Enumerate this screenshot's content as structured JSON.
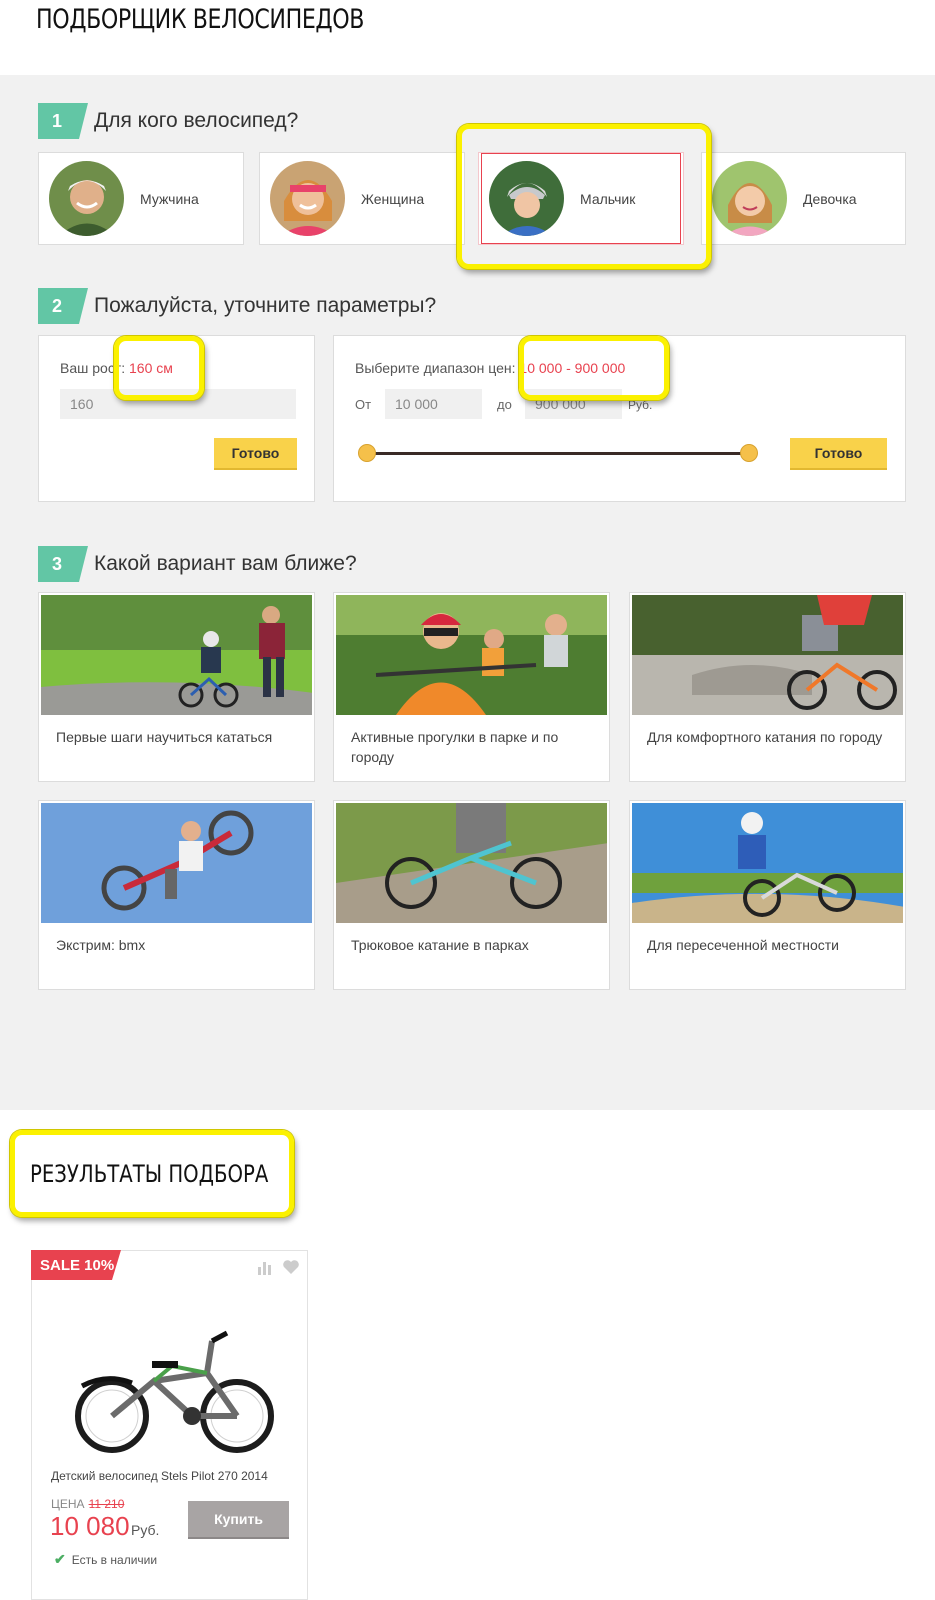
{
  "page": {
    "title": "ПОДБОРЩИК ВЕЛОСИПЕДОВ"
  },
  "step1": {
    "number": "1",
    "title": "Для кого велосипед?",
    "options": [
      {
        "label": "Мужчина",
        "icon": "man-avatar"
      },
      {
        "label": "Женщина",
        "icon": "woman-avatar"
      },
      {
        "label": "Мальчик",
        "icon": "boy-avatar",
        "selected": true
      },
      {
        "label": "Девочка",
        "icon": "girl-avatar"
      }
    ]
  },
  "step2": {
    "number": "2",
    "title": "Пожалуйста, уточните параметры?",
    "height": {
      "label": "Ваш рост:",
      "value_display": "160 см",
      "input_value": "160",
      "button": "Готово"
    },
    "price": {
      "label": "Выберите диапазон цен:",
      "value_display": "10 000 - 900 000",
      "from_label": "От",
      "from_value": "10 000",
      "to_label": "до",
      "to_value": "900 000",
      "currency": "Руб.",
      "button": "Готово",
      "slider_min_fraction": 0.0,
      "slider_max_fraction": 1.0
    }
  },
  "step3": {
    "number": "3",
    "title": "Какой вариант вам ближе?",
    "options": [
      {
        "label": "Первые шаги научиться кататься"
      },
      {
        "label": "Активные прогулки в парке и по городу"
      },
      {
        "label": "Для комфортного катания по городу"
      },
      {
        "label": "Экстрим: bmx"
      },
      {
        "label": "Трюковое катание в парках"
      },
      {
        "label": "Для пересеченной местности"
      }
    ]
  },
  "results": {
    "title": "РЕЗУЛЬТАТЫ ПОДБОРА",
    "products": [
      {
        "badge": "SALE 10%",
        "name": "Детский велосипед Stels Pilot 270 2014",
        "price_label": "ЦЕНА",
        "old_price": "11 210",
        "price": "10 080",
        "currency": "Руб.",
        "buy_button": "Купить",
        "stock": "Есть в наличии"
      }
    ]
  },
  "colors": {
    "accent_teal": "#62c6a5",
    "accent_red": "#e8424f",
    "button_yellow": "#f9d24a",
    "highlight_yellow": "#fbf100"
  }
}
